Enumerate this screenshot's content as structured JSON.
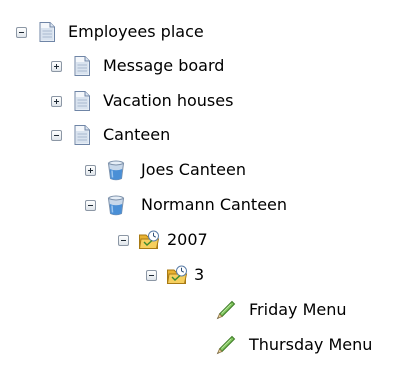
{
  "tree": {
    "nodes": [
      {
        "label": "Employees place",
        "icon": "page-icon",
        "state": "expanded",
        "level": 0
      },
      {
        "label": "Message board",
        "icon": "page-icon",
        "state": "collapsed",
        "level": 1
      },
      {
        "label": "Vacation houses",
        "icon": "page-icon",
        "state": "collapsed",
        "level": 1
      },
      {
        "label": "Canteen",
        "icon": "page-icon",
        "state": "expanded",
        "level": 1
      },
      {
        "label": "Joes Canteen",
        "icon": "cup-icon",
        "state": "collapsed",
        "level": 2
      },
      {
        "label": "Normann Canteen",
        "icon": "cup-icon",
        "state": "expanded",
        "level": 2
      },
      {
        "label": "2007",
        "icon": "calendar-folder-icon",
        "state": "expanded",
        "level": 3
      },
      {
        "label": "3",
        "icon": "calendar-folder-icon",
        "state": "expanded",
        "level": 4
      },
      {
        "label": "Friday Menu",
        "icon": "pencil-icon",
        "state": "leaf",
        "level": 5
      },
      {
        "label": "Thursday Menu",
        "icon": "pencil-icon",
        "state": "leaf",
        "level": 5
      }
    ]
  },
  "colors": {
    "page_icon": "#d9e3ef",
    "cup_icon": "#4a8fd6",
    "folder_icon": "#f0b93a",
    "pencil_icon": "#5aa640"
  }
}
